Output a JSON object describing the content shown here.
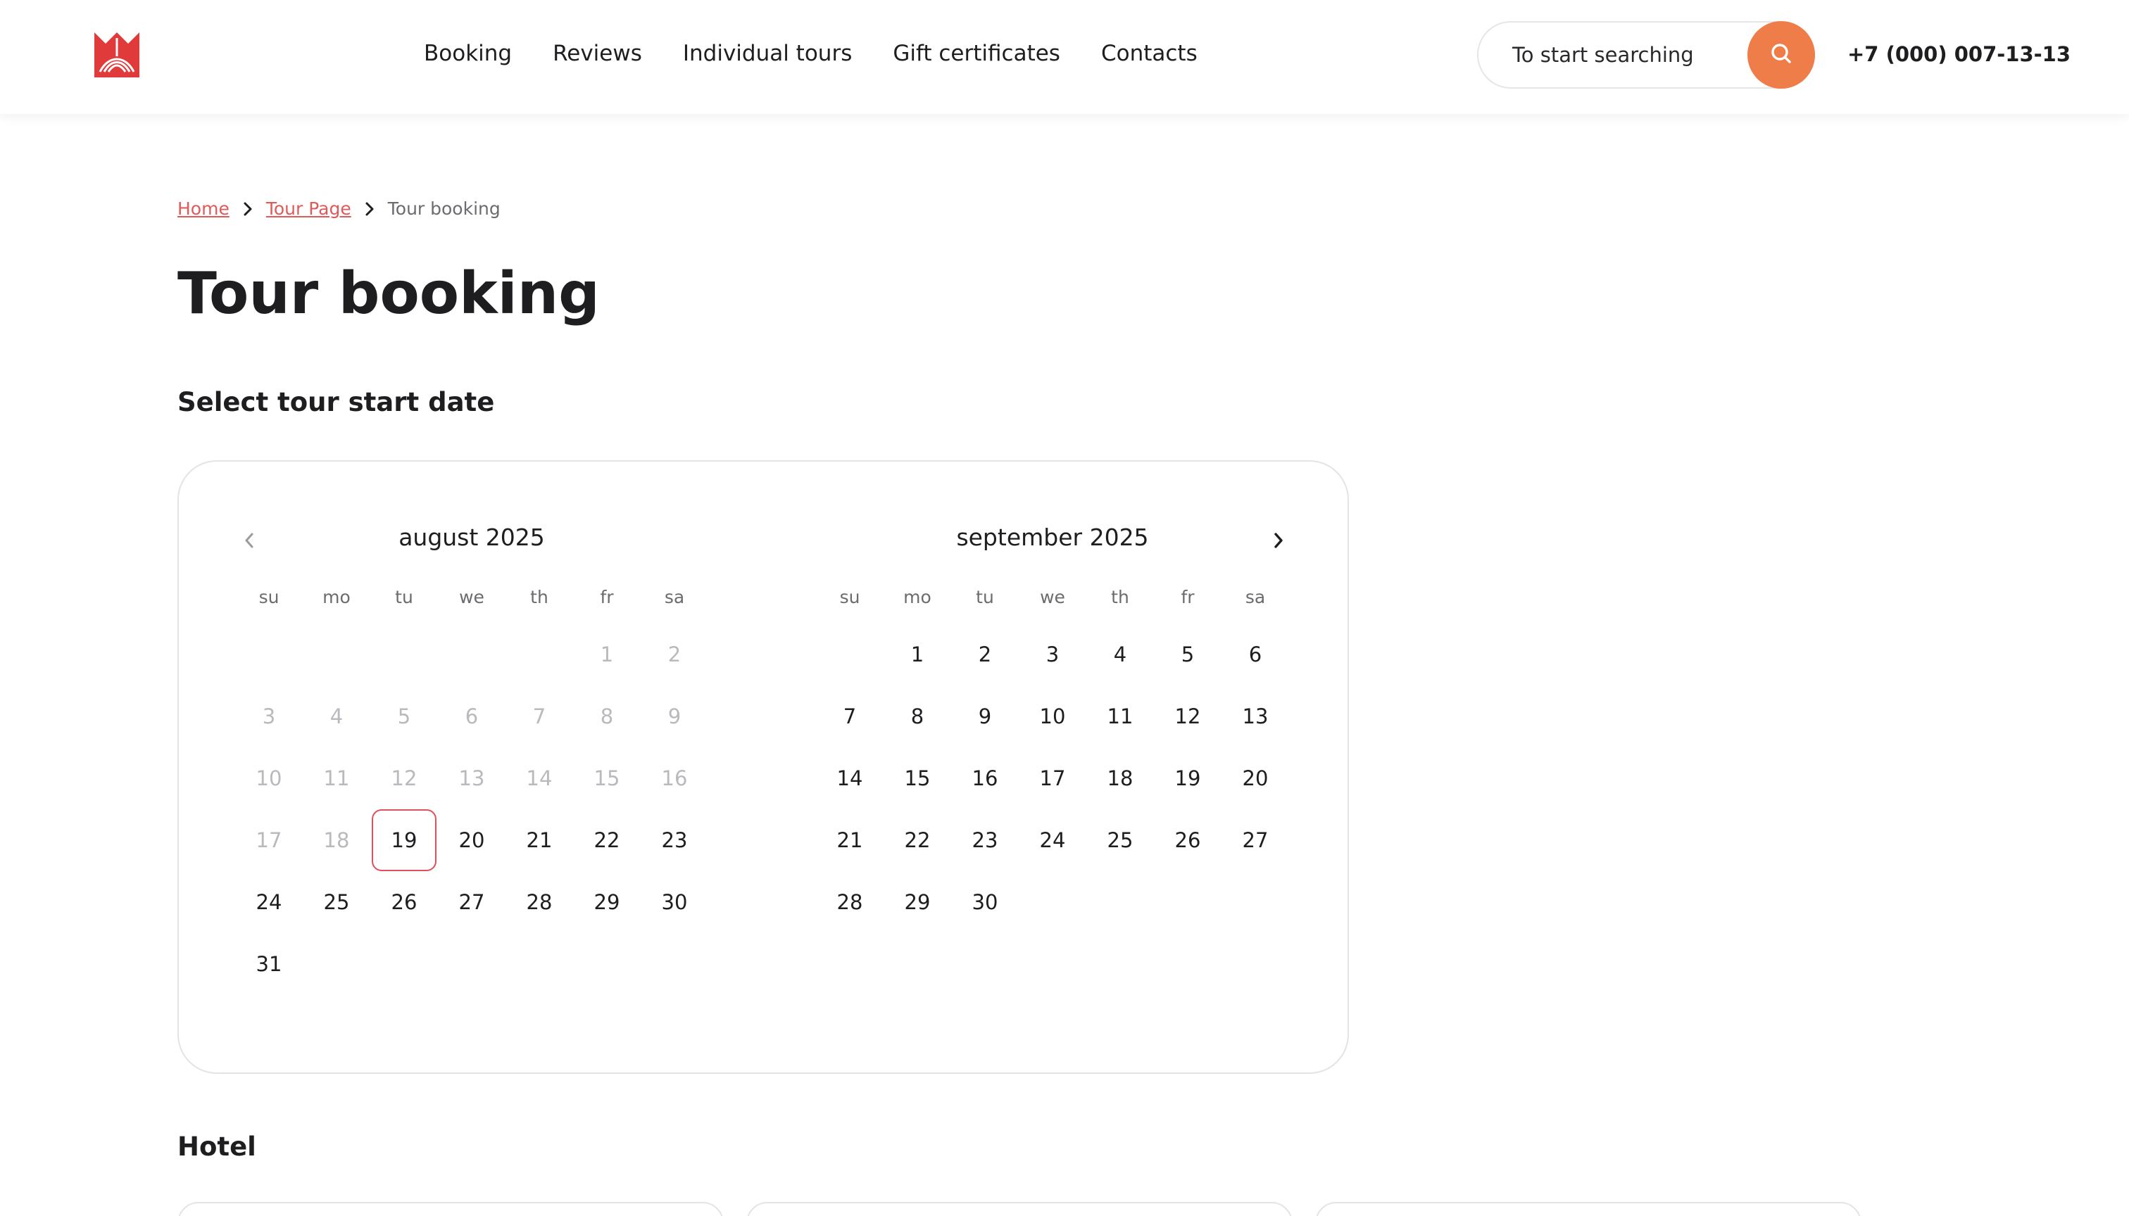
{
  "header": {
    "nav": [
      "Booking",
      "Reviews",
      "Individual tours",
      "Gift certificates",
      "Contacts"
    ],
    "search_placeholder": "To start searching",
    "phone": "+7 (000) 007-13-13"
  },
  "breadcrumb": {
    "home": "Home",
    "tour_page": "Tour Page",
    "current": "Tour booking"
  },
  "page_title": "Tour booking",
  "calendar_section_title": "Select tour start date",
  "calendar": {
    "weekdays": [
      "su",
      "mo",
      "tu",
      "we",
      "th",
      "fr",
      "sa"
    ],
    "selected_date": "2025-08-19",
    "months": [
      {
        "title": "august 2025",
        "first_weekday_index": 5,
        "days_in_month": 31,
        "past_until": 18,
        "selected_day": 19
      },
      {
        "title": "september 2025",
        "first_weekday_index": 1,
        "days_in_month": 30,
        "past_until": 0,
        "selected_day": null
      }
    ]
  },
  "hotel_section_title": "Hotel",
  "colors": {
    "accent_orange": "#ef7d4a",
    "accent_red": "#e05a5a",
    "logo_red": "#e03a3a",
    "text": "#1e1e21",
    "muted": "#b9b9be"
  },
  "icons": {
    "logo": "brand-logo",
    "search": "search-icon",
    "chevron_right": "chevron-right-icon",
    "chevron_left": "chevron-left-icon"
  }
}
